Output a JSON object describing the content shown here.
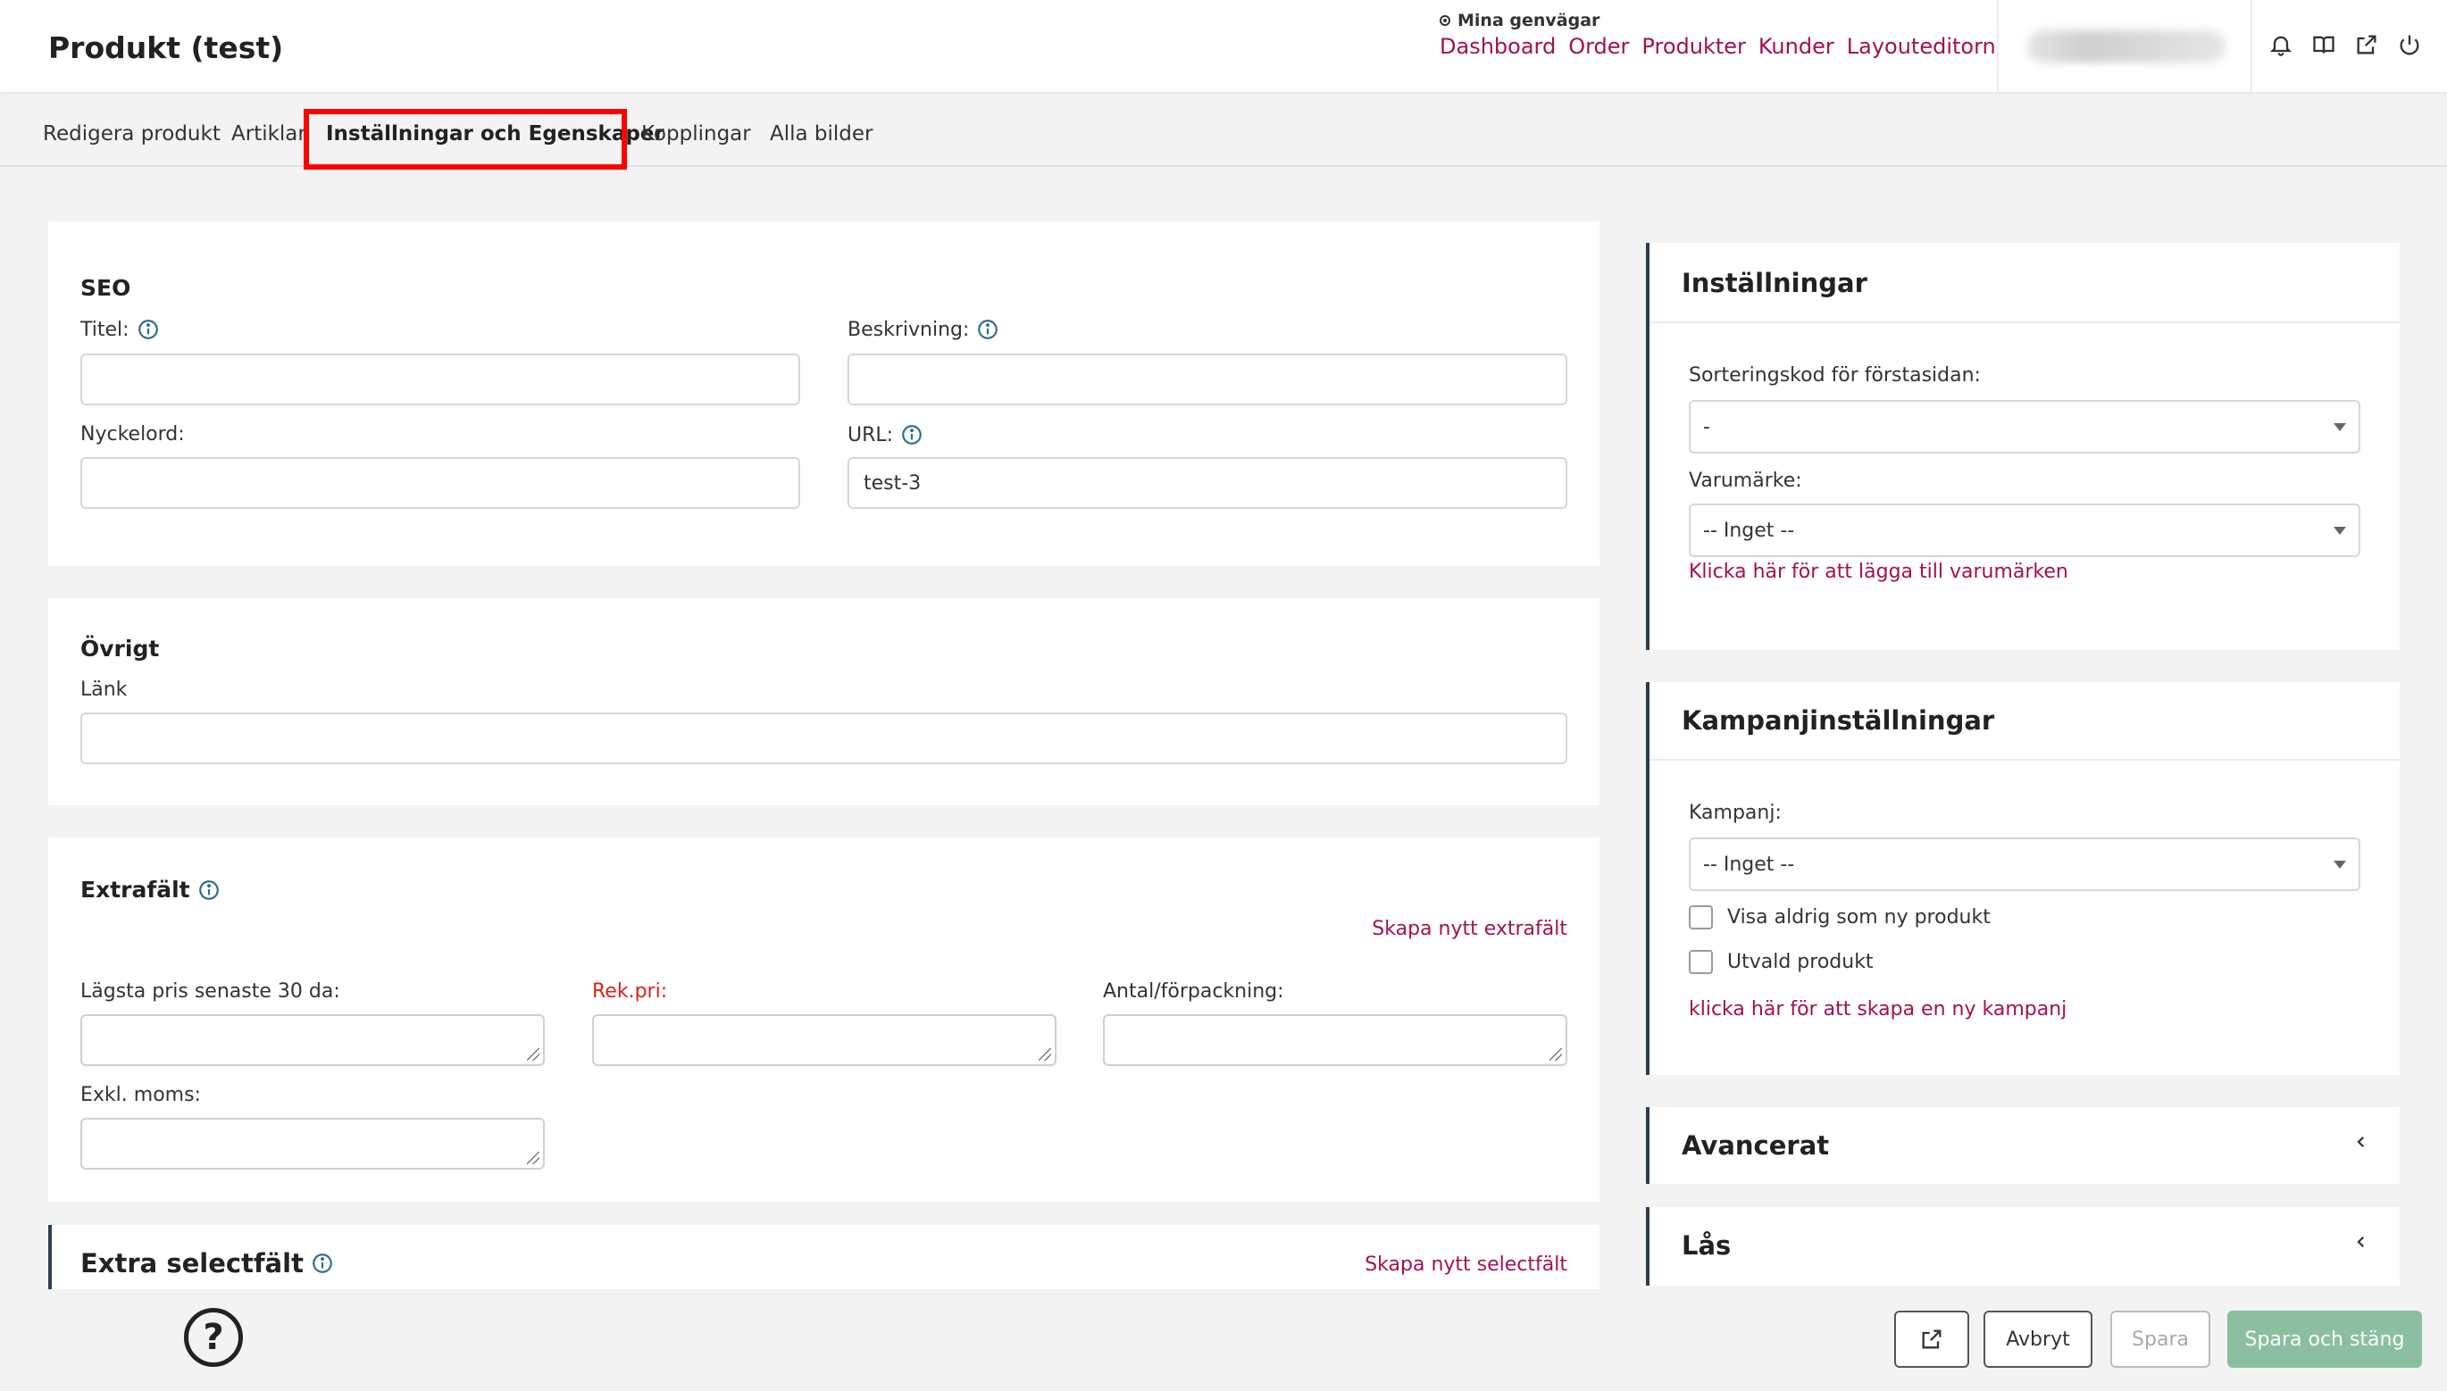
{
  "header": {
    "title": "Produkt (test)",
    "shortcuts_label": "Mina genvägar",
    "shortcuts": [
      "Dashboard",
      "Order",
      "Produkter",
      "Kunder",
      "Layouteditorn"
    ],
    "icons": [
      "bell-icon",
      "book-icon",
      "external-link-icon",
      "power-icon"
    ]
  },
  "tabs": [
    {
      "label": "Redigera produkt",
      "active": false
    },
    {
      "label": "Artiklar",
      "active": false
    },
    {
      "label": "Inställningar och Egenskaper",
      "active": true
    },
    {
      "label": "Kopplingar",
      "active": false
    },
    {
      "label": "Alla bilder",
      "active": false
    }
  ],
  "seo": {
    "title": "SEO",
    "titel_label": "Titel:",
    "titel_value": "",
    "beskrivning_label": "Beskrivning:",
    "beskrivning_value": "",
    "nyckelord_label": "Nyckelord:",
    "nyckelord_value": "",
    "url_label": "URL:",
    "url_value": "test-3"
  },
  "ovrigt": {
    "title": "Övrigt",
    "lank_label": "Länk",
    "lank_value": ""
  },
  "extrafalt": {
    "title": "Extrafält",
    "create_link": "Skapa nytt extrafält",
    "fields": [
      {
        "label": "Lägsta pris senaste 30 da:",
        "required": false
      },
      {
        "label": "Rek.pri:",
        "required": true
      },
      {
        "label": "Antal/förpackning:",
        "required": false
      },
      {
        "label": "Exkl. moms:",
        "required": false
      }
    ]
  },
  "extra_select": {
    "title": "Extra selectfält",
    "create_link": "Skapa nytt selectfält"
  },
  "installningar": {
    "title": "Inställningar",
    "sort_label": "Sorteringskod för förstasidan:",
    "sort_value": "-",
    "brand_label": "Varumärke:",
    "brand_value": "-- Inget --",
    "brand_link": "Klicka här för att lägga till varumärken"
  },
  "kampanj": {
    "title": "Kampanjinställningar",
    "kampanj_label": "Kampanj:",
    "kampanj_value": "-- Inget --",
    "check_new": "Visa aldrig som ny produkt",
    "check_selected": "Utvald produkt",
    "create_link": "klicka här för att skapa en ny kampanj"
  },
  "avancerat": {
    "title": "Avancerat"
  },
  "las": {
    "title": "Lås"
  },
  "footer": {
    "help": "?",
    "cancel": "Avbryt",
    "save": "Spara",
    "save_close": "Spara och stäng"
  },
  "colors": {
    "accent": "#a4104f",
    "required": "#d6231d",
    "primary_button": "#8bbfa0",
    "panel_accent": "#2d3e50",
    "highlight": "#ff0000"
  }
}
